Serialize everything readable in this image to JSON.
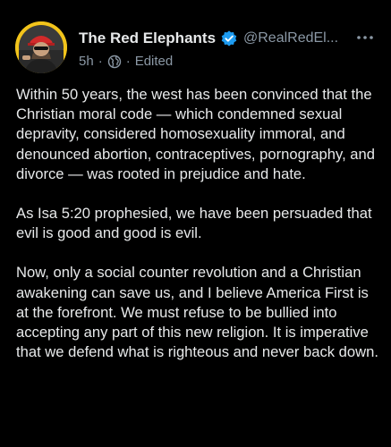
{
  "post": {
    "author_name": "The Red Elephants",
    "author_handle": "@RealRedEl...",
    "time": "5h",
    "edited_label": "Edited",
    "more_icon": "more-dots-icon",
    "verified_icon": "verified-badge-icon",
    "audience_icon": "globe-icon",
    "paragraphs": [
      "Within 50 years, the west has been convinced that the Christian moral code — which condemned sexual depravity, considered homosexuality immoral, and denounced abortion, contraceptives, pornography, and divorce — was rooted in prejudice and hate.",
      "As Isa 5:20 prophesied, we have been persuaded that evil is good and good is evil.",
      "Now, only a social counter revolution and a Christian awakening can save us, and I believe America First is at the forefront. We must refuse to be bullied into accepting any part of this new religion. It is imperative that we defend what is righteous and never back down."
    ]
  },
  "colors": {
    "background": "#000000",
    "text": "#e7e9ea",
    "muted": "#8b98a5",
    "verified": "#1d9bf0",
    "avatar_ring": "#f2c41b"
  }
}
